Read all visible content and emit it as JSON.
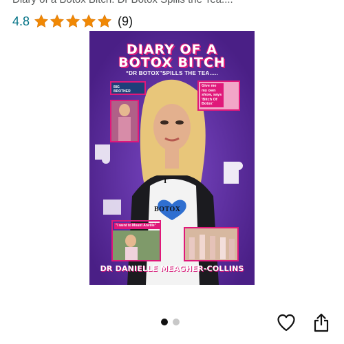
{
  "product": {
    "title_partial": "Diary of a Botox Bitch: Dr Botox Spills the Tea...."
  },
  "rating": {
    "value": "4.8",
    "stars_filled": 4.8,
    "review_count": "(9)",
    "star_color": "#f08804"
  },
  "cover": {
    "title_line1": "DIARY OF A",
    "title_line2": "BOTOX BITCH",
    "subtitle": "“DR BOTOX”SPILLS THE TEA.....",
    "quote_top": "Give me my own show, says 'Bitch Of Botox'",
    "quote_bottom": "\"I went to Mount Anville\"",
    "badge_big_brother": "BIG BROTHER",
    "shirt_top": "I",
    "shirt_bottom": "BOTOX",
    "author": "DR DANIELLE MEAGHER-COLLINS",
    "background_color": "#5a2a9c",
    "accent_color": "#e0187a"
  },
  "carousel": {
    "active_index": 0,
    "count": 2
  },
  "actions": {
    "wishlist_icon": "heart-icon",
    "share_icon": "share-icon"
  }
}
